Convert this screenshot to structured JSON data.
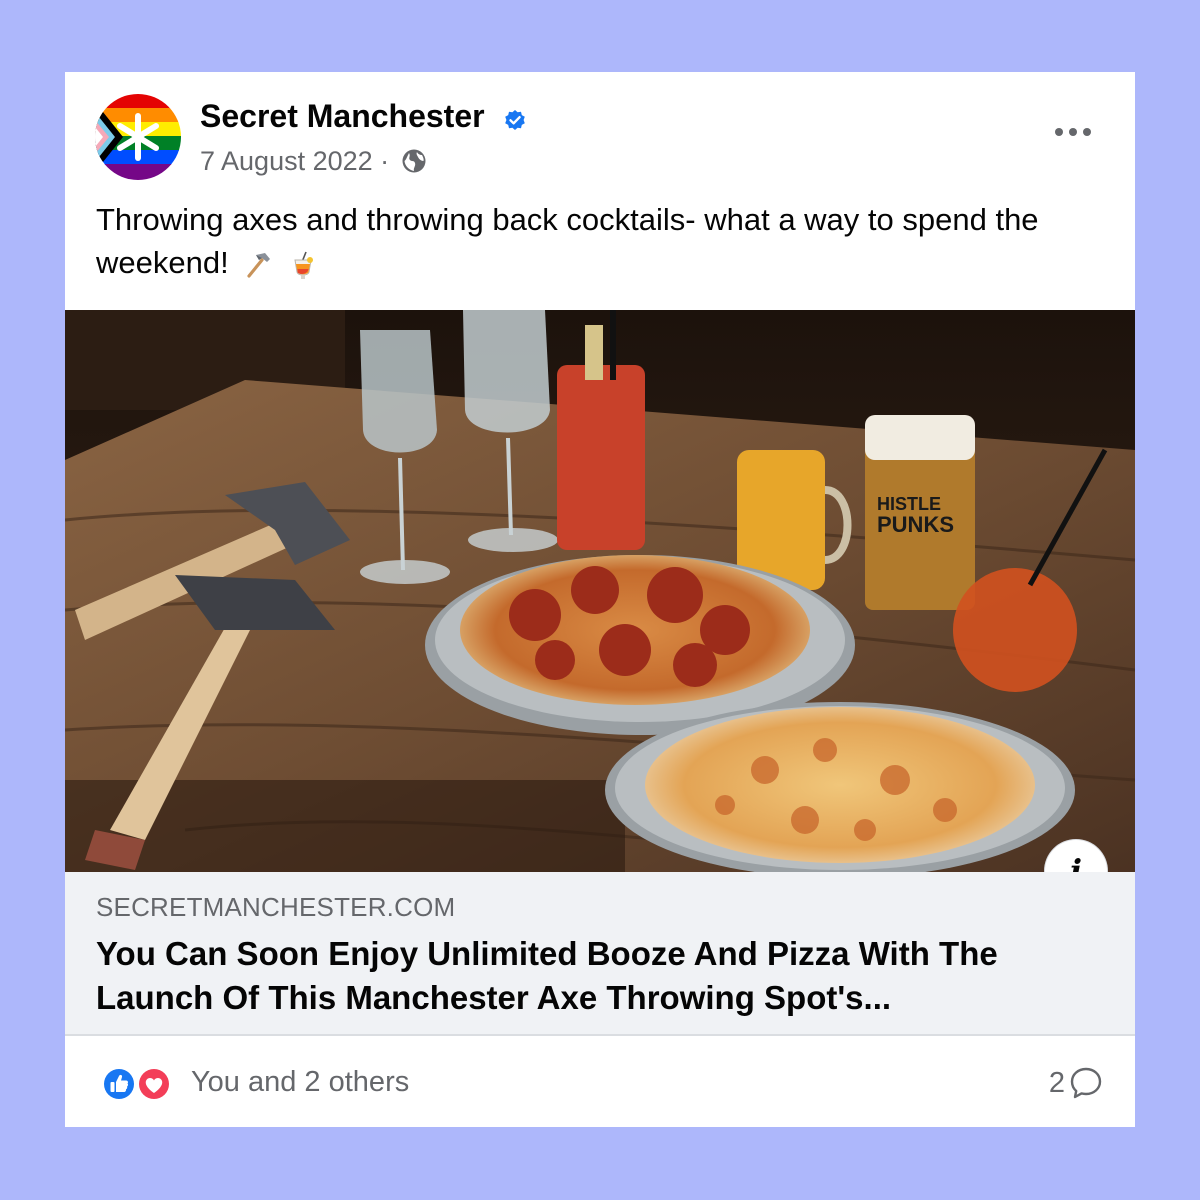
{
  "post": {
    "page_name": "Secret Manchester",
    "date": "7 August 2022",
    "meta_separator": "·",
    "visibility_icon": "globe-icon",
    "caption": "Throwing axes and throwing back cocktails- what a way to spend the weekend!",
    "caption_emojis": [
      "hammer-icon",
      "cocktail-icon"
    ]
  },
  "link_preview": {
    "domain": "SECRETMANCHESTER.COM",
    "headline": "You Can Soon Enjoy Unlimited Booze And Pizza With The Launch Of This Manchester Axe Throwing Spot's...",
    "info_label": "i"
  },
  "engagement": {
    "reaction_icons": [
      "like-icon",
      "love-icon"
    ],
    "reactions_text": "You and 2 others",
    "comment_count": "2"
  },
  "colors": {
    "background": "#adb7fb",
    "verified_blue": "#1877f2",
    "love_red": "#f33e58"
  }
}
